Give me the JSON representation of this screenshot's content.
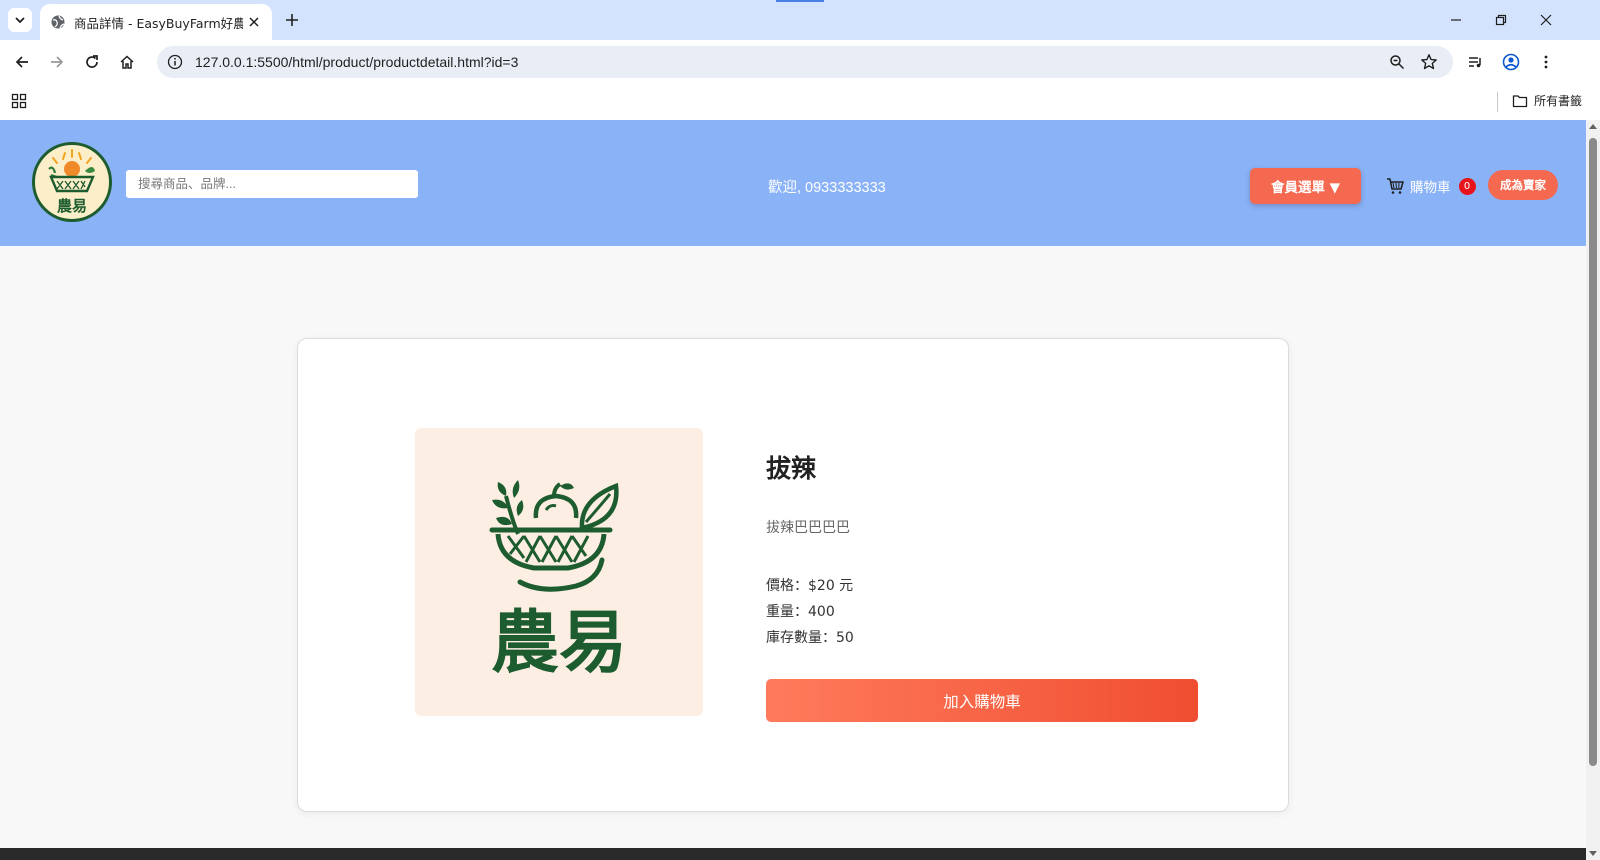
{
  "browser": {
    "tab_title": "商品詳情 - EasyBuyFarm好農易",
    "url": "127.0.0.1:5500/html/product/productdetail.html?id=3",
    "bookmarks_all_label": "所有書籤"
  },
  "header": {
    "logo_text": "農易",
    "search_placeholder": "搜尋商品、品牌...",
    "welcome_text": "歡迎, 0933333333",
    "member_menu_label": "會員選單 ▼",
    "cart_label": "購物車",
    "cart_count": "0",
    "become_seller_label": "成為賣家"
  },
  "product": {
    "image_logo_text": "農易",
    "name": "拔辣",
    "description": "拔辣巴巴巴巴",
    "price_label": "價格：$20 元",
    "weight_label": "重量：400",
    "stock_label": "庫存數量：50",
    "add_to_cart_label": "加入購物車"
  },
  "colors": {
    "header_bg": "#8ab2f7",
    "accent": "#f4694f",
    "logo_green": "#1d5c2e",
    "image_bg": "#fdeee4",
    "badge_red": "#e8141c"
  }
}
